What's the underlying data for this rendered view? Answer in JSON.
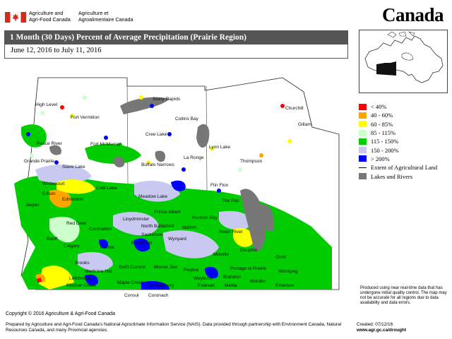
{
  "header": {
    "dept_en_line1": "Agriculture and",
    "dept_en_line2": "Agri-Food Canada",
    "dept_fr_line1": "Agriculture et",
    "dept_fr_line2": "Agroalimentaire Canada",
    "wordmark": "Canada"
  },
  "title": "1 Month (30 Days) Percent of Average Precipitation  (Prairie Region)",
  "date_range": "June 12, 2016 to July 11, 2016",
  "legend": {
    "items": [
      {
        "label": "< 40%",
        "color": "#ff0000"
      },
      {
        "label": "40 - 60%",
        "color": "#ffa500"
      },
      {
        "label": "60 - 85%",
        "color": "#ffff00"
      },
      {
        "label": "85 - 115%",
        "color": "#ccffcc"
      },
      {
        "label": "115 - 150%",
        "color": "#00cc00"
      },
      {
        "label": "150 - 200%",
        "color": "#c8c8f0"
      },
      {
        "label": "> 200%",
        "color": "#0000ff"
      }
    ],
    "extent_label": "Extent of Agricultural Land",
    "lakes_label": "Lakes and Rivers",
    "lakes_color": "#777777"
  },
  "map_labels": {
    "high_level": "High Level",
    "fort_vermilion": "Fort Vermilion",
    "stony_rapids": "Stony Rapids",
    "collins_bay": "Collins Bay",
    "churchill": "Churchill",
    "peace_river": "Peace River",
    "fort_mcmurray": "Fort McMurray",
    "cree_lake": "Cree Lake",
    "lynn_lake": "Lynn Lake",
    "gillam": "Gillam",
    "grande_prairie": "Grande Prairie",
    "slave_lake": "Slave Lake",
    "buffalo_narrows": "Buffalo Narrows",
    "la_ronge": "La Ronge",
    "thompson": "Thompson",
    "whitecourt": "Whitecourt",
    "cold_lake": "Cold Lake",
    "flin_flon": "Flin Flon",
    "edson": "Edson",
    "edmonton": "Edmonton",
    "meadow_lake": "Meadow Lake",
    "the_pas": "The Pas",
    "jasper": "Jasper",
    "lloydminster": "Lloydminster",
    "prince_albert": "Prince Albert",
    "hudson_bay": "Hudson Bay",
    "red_deer": "Red Deer",
    "coronation": "Coronation",
    "north_battleford": "North Battleford",
    "melfort": "Melfort",
    "swan_river": "Swan River",
    "banff": "Banff",
    "saskatoon": "Saskatoon",
    "calgary": "Calgary",
    "wynyard": "Wynyard",
    "rosetown": "Rosetown",
    "hanna": "Hanna",
    "dauphin": "Dauphin",
    "gimli": "Gimli",
    "brooks": "Brooks",
    "melville": "Melville",
    "medicine_hat": "Medicine Hat",
    "swift_current": "Swift Current",
    "moose_jaw": "Moose Jaw",
    "regina": "Regina",
    "portage_la_prairie": "Portage la Prairie",
    "winnipeg": "Winnipeg",
    "lethbridge": "Lethbridge",
    "pincher_creek": "Pincher Creek",
    "maple_creek": "Maple Creek",
    "estevan": "Estevan",
    "weyburn": "Weyburn",
    "brandon": "Brandon",
    "melita": "Melita",
    "morden": "Morden",
    "emerson": "Emerson",
    "consul": "Consul",
    "coronach": "Coronach",
    "gravelbourg": "Gravelbourg"
  },
  "disclaimer": "Produced using near real-time data that has undergone initial quality control.  The map may not be accurate for all regions due to data availability and data errors.",
  "footer": {
    "copyright": "Copyright © 2016 Agriculture & Agri-Food Canada",
    "prepared": "Prepared by Agriculture and Agri-Food Canada's National Agroclimate Information Service (NAIS).  Data provided through partnership with Environment Canada, Natural Resources Canada, and many Provincial agencies.",
    "created": "Created: 07/12/16",
    "url": "www.agr.gc.ca/drought"
  }
}
